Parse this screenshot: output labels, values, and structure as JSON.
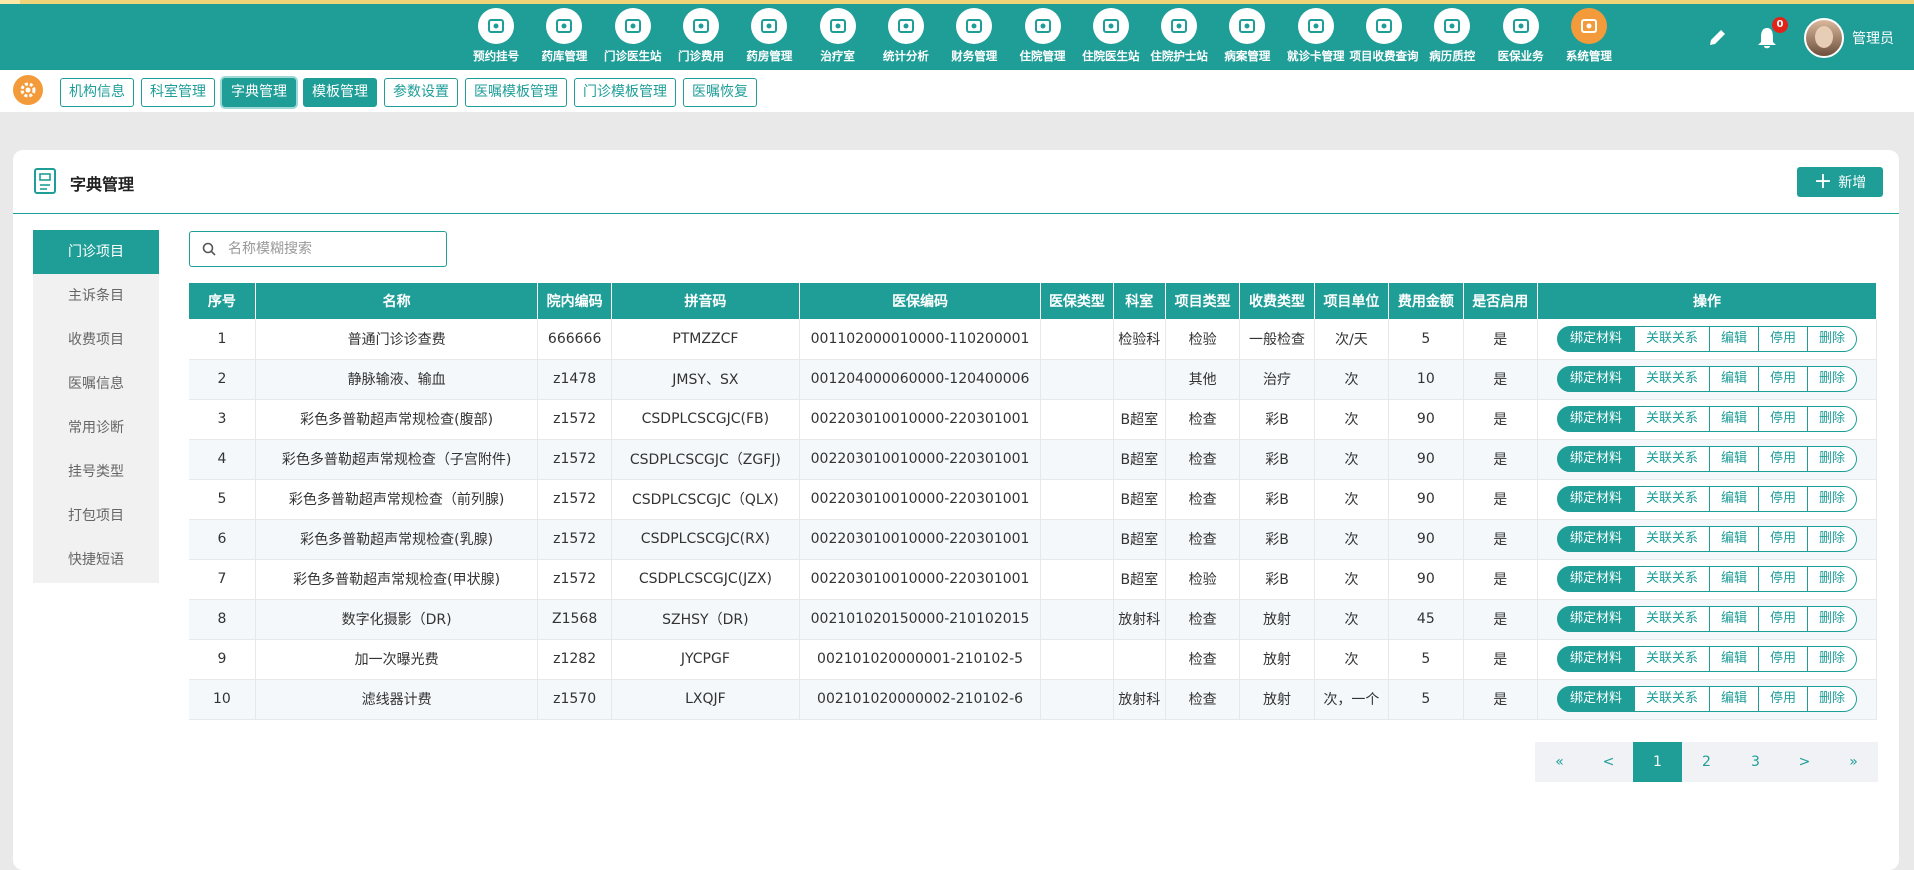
{
  "nav": {
    "items": [
      {
        "label": "预约挂号",
        "icon": "calendar-icon"
      },
      {
        "label": "药库管理",
        "icon": "warehouse-icon"
      },
      {
        "label": "门诊医生站",
        "icon": "doctor-icon"
      },
      {
        "label": "门诊费用",
        "icon": "yen-icon"
      },
      {
        "label": "药房管理",
        "icon": "pill-icon"
      },
      {
        "label": "治疗室",
        "icon": "nurse-icon"
      },
      {
        "label": "统计分析",
        "icon": "chart-icon"
      },
      {
        "label": "财务管理",
        "icon": "gear-icon"
      },
      {
        "label": "住院管理",
        "icon": "bed-icon"
      },
      {
        "label": "住院医生站",
        "icon": "doctor-card-icon"
      },
      {
        "label": "住院护士站",
        "icon": "nurse-station-icon"
      },
      {
        "label": "病案管理",
        "icon": "record-icon"
      },
      {
        "label": "就诊卡管理",
        "icon": "card-icon"
      },
      {
        "label": "项目收费查询",
        "icon": "search-doc-icon"
      },
      {
        "label": "病历质控",
        "icon": "control-icon"
      },
      {
        "label": "医保业务",
        "icon": "insurance-icon"
      },
      {
        "label": "系统管理",
        "icon": "settings-icon"
      }
    ],
    "notification_count": "0",
    "username": "管理员"
  },
  "subtabs": [
    "机构信息",
    "科室管理",
    "字典管理",
    "模板管理",
    "参数设置",
    "医嘱模板管理",
    "门诊模板管理",
    "医嘱恢复"
  ],
  "panel": {
    "title": "字典管理",
    "add_label": "新增"
  },
  "sidebar": [
    "门诊项目",
    "主诉条目",
    "收费项目",
    "医嘱信息",
    "常用诊断",
    "挂号类型",
    "打包项目",
    "快捷短语"
  ],
  "search": {
    "placeholder": "名称模糊搜索"
  },
  "table": {
    "headers": [
      "序号",
      "名称",
      "院内编码",
      "拼音码",
      "医保编码",
      "医保类型",
      "科室",
      "项目类型",
      "收费类型",
      "项目单位",
      "费用金额",
      "是否启用",
      "操作"
    ],
    "rows": [
      [
        "1",
        "普通门诊诊查费",
        "666666",
        "PTMZZCF",
        "001102000010000-110200001",
        "",
        "检验科",
        "检验",
        "一般检查",
        "次/天",
        "5",
        "是"
      ],
      [
        "2",
        "静脉输液、输血",
        "z1478",
        "JMSY、SX",
        "001204000060000-120400006",
        "",
        "",
        "其他",
        "治疗",
        "次",
        "10",
        "是"
      ],
      [
        "3",
        "彩色多普勒超声常规检查(腹部)",
        "z1572",
        "CSDPLCSCGJC(FB)",
        "002203010010000-220301001",
        "",
        "B超室",
        "检查",
        "彩B",
        "次",
        "90",
        "是"
      ],
      [
        "4",
        "彩色多普勒超声常规检查（子宫附件)",
        "z1572",
        "CSDPLCSCGJC（ZGFJ)",
        "002203010010000-220301001",
        "",
        "B超室",
        "检查",
        "彩B",
        "次",
        "90",
        "是"
      ],
      [
        "5",
        "彩色多普勒超声常规检查（前列腺)",
        "z1572",
        "CSDPLCSCGJC（QLX)",
        "002203010010000-220301001",
        "",
        "B超室",
        "检查",
        "彩B",
        "次",
        "90",
        "是"
      ],
      [
        "6",
        "彩色多普勒超声常规检查(乳腺)",
        "z1572",
        "CSDPLCSCGJC(RX)",
        "002203010010000-220301001",
        "",
        "B超室",
        "检查",
        "彩B",
        "次",
        "90",
        "是"
      ],
      [
        "7",
        "彩色多普勒超声常规检查(甲状腺)",
        "z1572",
        "CSDPLCSCGJC(JZX)",
        "002203010010000-220301001",
        "",
        "B超室",
        "检验",
        "彩B",
        "次",
        "90",
        "是"
      ],
      [
        "8",
        "数字化摄影（DR)",
        "Z1568",
        "SZHSY（DR)",
        "002101020150000-210102015",
        "",
        "放射科",
        "检查",
        "放射",
        "次",
        "45",
        "是"
      ],
      [
        "9",
        "加一次曝光费",
        "z1282",
        "JYCPGF",
        "002101020000001-210102-5",
        "",
        "",
        "检查",
        "放射",
        "次",
        "5",
        "是"
      ],
      [
        "10",
        "滤线器计费",
        "z1570",
        "LXQJF",
        "002101020000002-210102-6",
        "",
        "放射科",
        "检查",
        "放射",
        "次，一个",
        "5",
        "是"
      ]
    ],
    "actions": [
      "绑定材料",
      "关联关系",
      "编辑",
      "停用",
      "删除"
    ]
  },
  "pager": [
    "«",
    "<",
    "1",
    "2",
    "3",
    ">",
    "»"
  ]
}
